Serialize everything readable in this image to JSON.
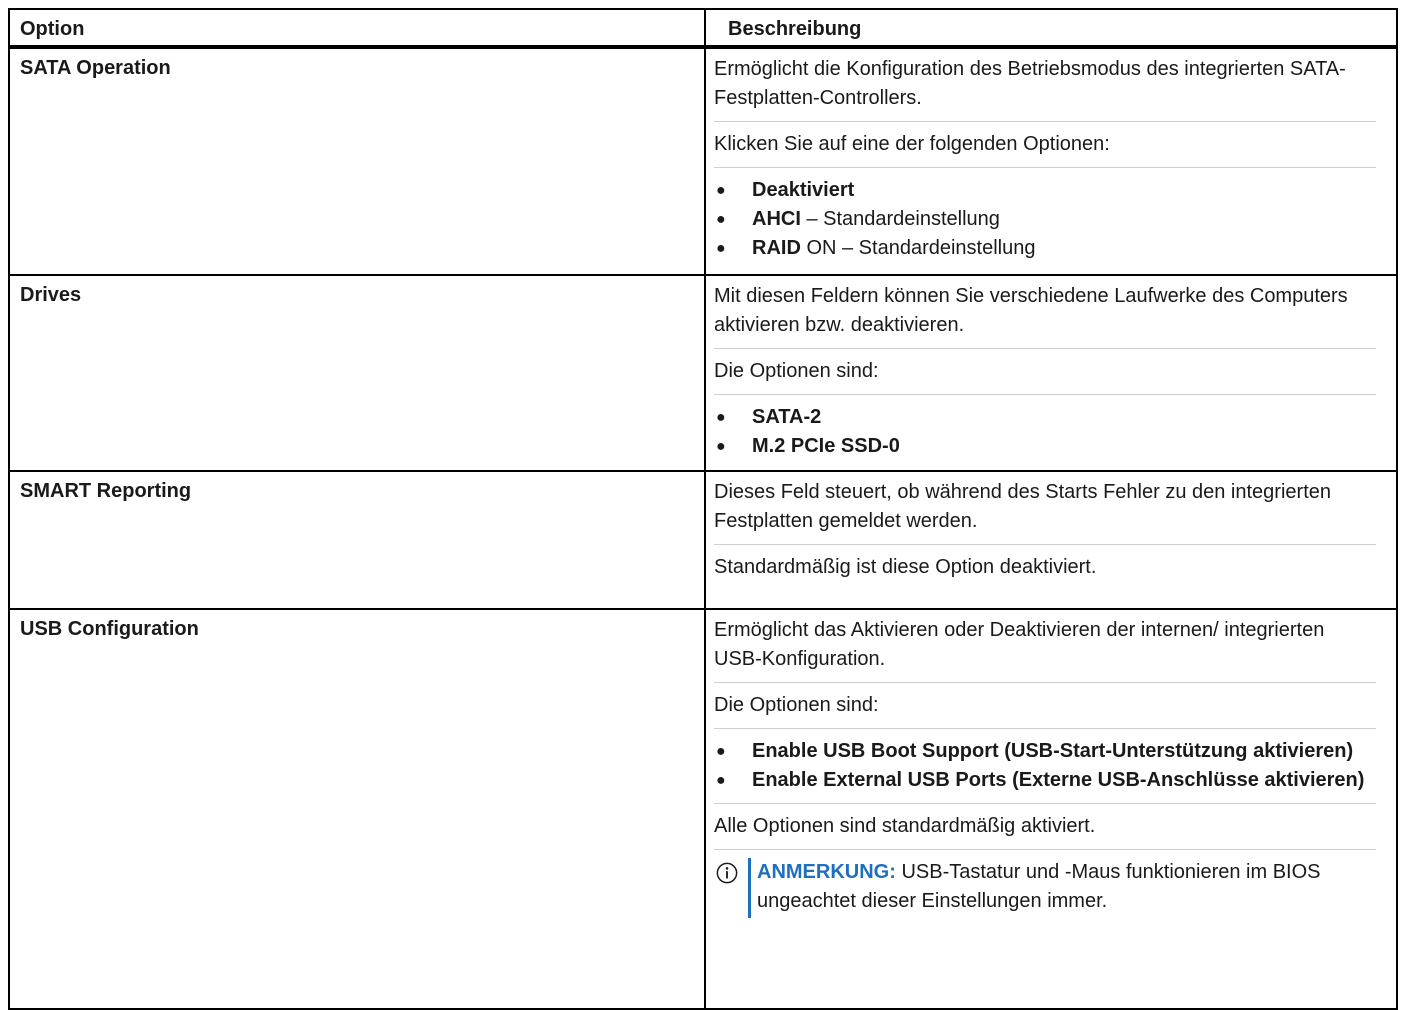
{
  "header": {
    "option": "Option",
    "description": "Beschreibung"
  },
  "rows": [
    {
      "option": "SATA Operation",
      "p1": "Ermöglicht die Konfiguration des Betriebsmodus des integrierten SATA-Festplatten-Controllers.",
      "p2": "Klicken Sie auf eine der folgenden Optionen:",
      "bullets": [
        {
          "bold": "Deaktiviert",
          "rest": ""
        },
        {
          "bold": "AHCI",
          "rest": " – Standardeinstellung"
        },
        {
          "bold": "RAID",
          "rest": " ON – Standardeinstellung"
        }
      ]
    },
    {
      "option": "Drives",
      "p1": "Mit diesen Feldern können Sie verschiedene Laufwerke des Computers aktivieren bzw. deaktivieren.",
      "p2": "Die Optionen sind:",
      "bullets": [
        {
          "bold": "SATA-2"
        },
        {
          "bold": "M.2 PCIe SSD-0"
        }
      ]
    },
    {
      "option": "SMART Reporting",
      "p1": "Dieses Feld steuert, ob während des Starts Fehler zu den integrierten Festplatten gemeldet werden.",
      "p2": "Standardmäßig ist diese Option deaktiviert."
    },
    {
      "option": "USB Configuration",
      "p1": "Ermöglicht das Aktivieren oder Deaktivieren der internen/ integrierten USB-Konfiguration.",
      "p2": "Die Optionen sind:",
      "bullets": [
        {
          "bold": "Enable USB Boot Support (USB-Start-Unterstützung aktivieren)"
        },
        {
          "bold": "Enable External USB Ports (Externe USB-Anschlüsse aktivieren)"
        }
      ],
      "p3": "Alle Optionen sind standardmäßig aktiviert.",
      "note_label": "ANMERKUNG:",
      "note_text": " USB-Tastatur und -Maus funktionieren im BIOS ungeachtet dieser Einstellungen immer.",
      "note_icon": "info-icon"
    }
  ],
  "colors": {
    "note_accent": "#1f6fbf"
  }
}
